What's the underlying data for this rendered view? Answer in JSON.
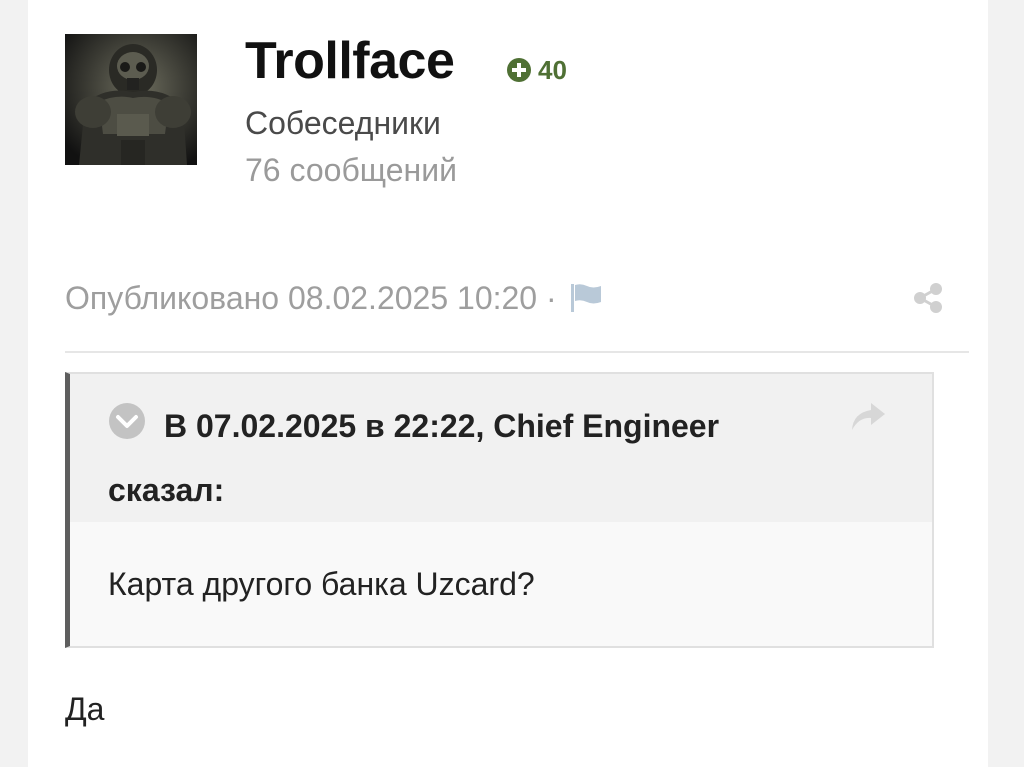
{
  "author": {
    "name": "Trollface",
    "reputation": "40",
    "group": "Собеседники",
    "posts": "76 сообщений",
    "avatar_icon": "power-armor-avatar"
  },
  "post": {
    "meta_text": "Опубликовано 08.02.2025 10:20 ·",
    "report_icon": "flag-icon",
    "share_icon": "share-icon",
    "quote": {
      "citation": "В 07.02.2025 в 22:22, Chief Engineer сказал:",
      "body": "Карта другого банка Uzcard?"
    },
    "content": "Да"
  },
  "colors": {
    "reputation": "#4f7034",
    "muted_text": "#9e9e9e",
    "quote_border": "#5e5e5e",
    "icon_gray": "#b9c9d8"
  }
}
